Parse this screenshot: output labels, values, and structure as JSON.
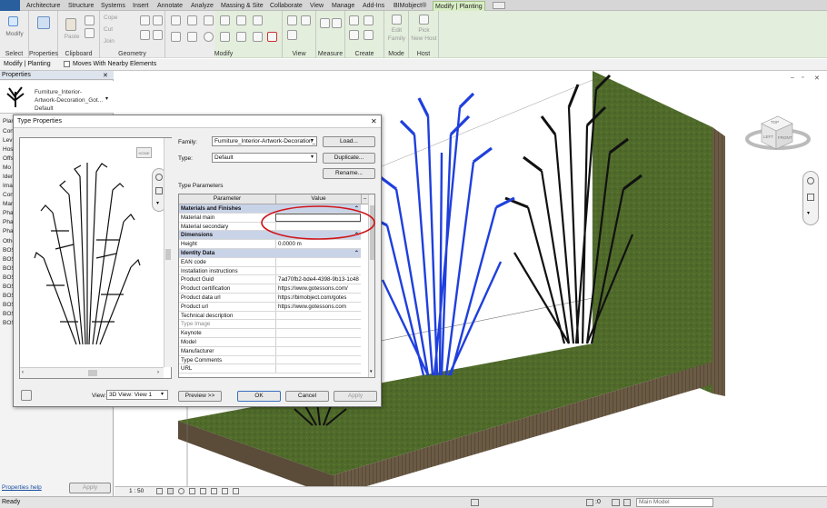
{
  "tabs": [
    "Architecture",
    "Structure",
    "Systems",
    "Insert",
    "Annotate",
    "Analyze",
    "Massing & Site",
    "Collaborate",
    "View",
    "Manage",
    "Add-Ins",
    "BIMobject®",
    "Modify | Planting"
  ],
  "ribbon": {
    "select": {
      "btn": "Modify",
      "label": "Select"
    },
    "properties": {
      "btn": "Properties",
      "label": "Properties"
    },
    "clipboard": {
      "paste": "Paste",
      "label": "Clipboard"
    },
    "geometry": {
      "cope": "Cope",
      "cut": "Cut",
      "join": "Join",
      "label": "Geometry"
    },
    "modify_label": "Modify",
    "view_label": "View",
    "measure_label": "Measure",
    "create_label": "Create",
    "mode": {
      "edit": "Edit",
      "family": "Family",
      "label": "Mode"
    },
    "host": {
      "pick": "Pick",
      "newhost": "New Host",
      "label": "Host"
    }
  },
  "optionsbar": {
    "context": "Modify | Planting",
    "moves_label": "Moves With Nearby Elements"
  },
  "left": {
    "header": "Properties",
    "family_line1": "Furniture_Interior-",
    "family_line2": "Artwork-Decoration_Got...",
    "family_line3": "Default",
    "items": [
      "Plan",
      "Cons",
      "Lev",
      "Hos",
      "Offs",
      "Mo",
      "Iden",
      "Ima",
      "Con",
      "Mar",
      "Phas",
      "Pha",
      "Pha",
      "Othe",
      "BOS",
      "BOS",
      "BOS",
      "BOS",
      "BOS",
      "BOS",
      "BOS",
      "BOS",
      "BOS"
    ],
    "help": "Properties help",
    "apply": "Apply"
  },
  "dialog": {
    "title": "Type Properties",
    "family_label": "Family:",
    "family_value": "Furniture_Interior-Artwork-Decoration_",
    "load": "Load...",
    "type_label": "Type:",
    "type_value": "Default",
    "duplicate": "Duplicate...",
    "rename": "Rename...",
    "section": "Type Parameters",
    "col_param": "Parameter",
    "col_value": "Value",
    "rows": [
      {
        "p": "Materials and Finishes",
        "v": "",
        "g": true
      },
      {
        "p": "Material main",
        "v": "",
        "box": true
      },
      {
        "p": "Material secondary",
        "v": ""
      },
      {
        "p": "Dimensions",
        "v": "",
        "g": true
      },
      {
        "p": "Height",
        "v": "0.0000 m"
      },
      {
        "p": "Identity Data",
        "v": "",
        "g": true
      },
      {
        "p": "EAN code",
        "v": ""
      },
      {
        "p": "Installation instructions",
        "v": ""
      },
      {
        "p": "Product Guid",
        "v": "7ad70fb2-bde4-4398-9b13-1c48"
      },
      {
        "p": "Product certification",
        "v": "https://www.gotessons.com/"
      },
      {
        "p": "Product data url",
        "v": "https://bimobject.com/gotes"
      },
      {
        "p": "Product url",
        "v": "https://www.gotessons.com"
      },
      {
        "p": "Technical description",
        "v": ""
      },
      {
        "p": "Type Image",
        "v": "",
        "gray": true
      },
      {
        "p": "Keynote",
        "v": ""
      },
      {
        "p": "Model",
        "v": ""
      },
      {
        "p": "Manufacturer",
        "v": ""
      },
      {
        "p": "Type Comments",
        "v": ""
      },
      {
        "p": "URL",
        "v": ""
      }
    ],
    "home": "HOME",
    "view_label": "View:",
    "view_value": "3D View: View 1",
    "preview": "Preview >>",
    "ok": "OK",
    "cancel": "Cancel",
    "apply": "Apply"
  },
  "viewcube": {
    "top": "TOP",
    "left": "LEFT",
    "front": "FRONT"
  },
  "status": {
    "ready": "Ready",
    "scale": "1 : 50",
    "zero": ":0",
    "model": "Main Model"
  },
  "colors": {
    "accent": "#d9eec4",
    "selected": "#1f3fdd",
    "grass": "#4f6a2a",
    "wood": "#6b5b45",
    "ellipse": "#d0161a"
  }
}
